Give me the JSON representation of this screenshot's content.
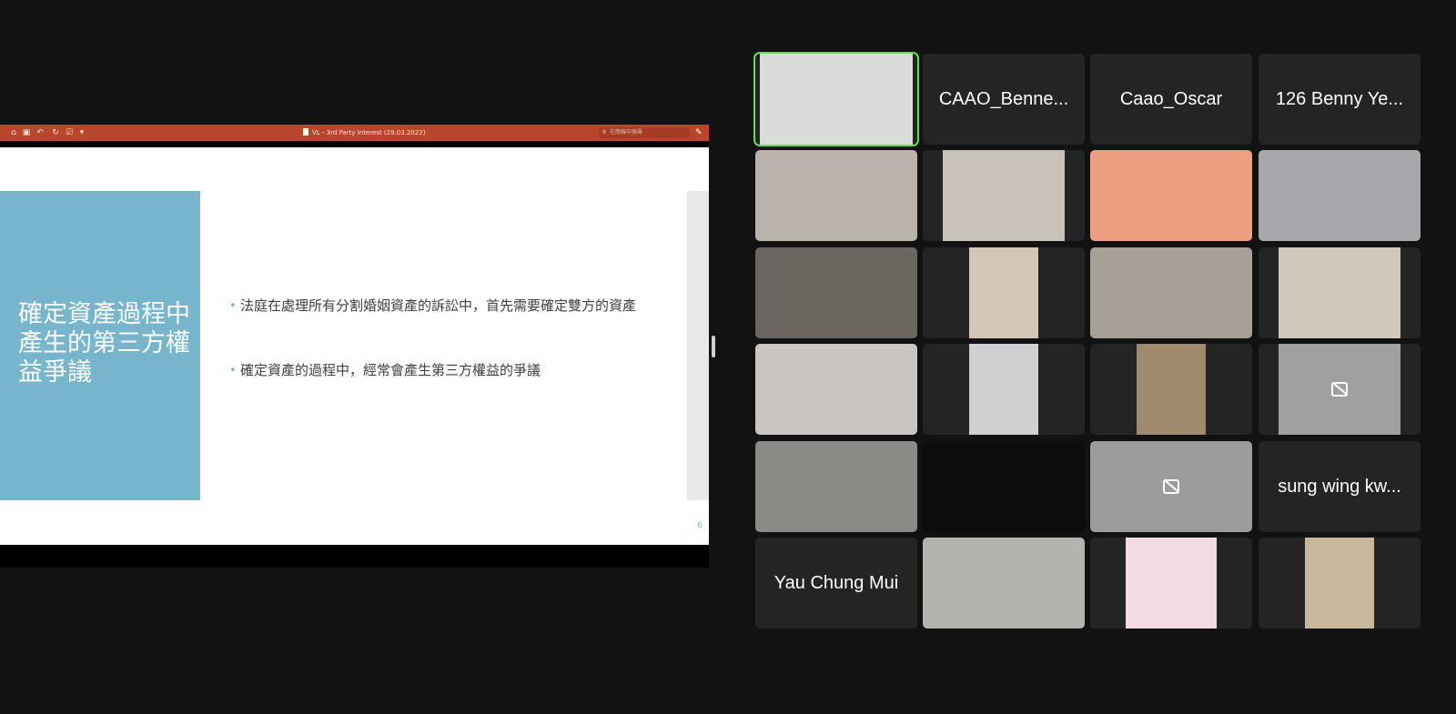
{
  "share": {
    "toolbar": {
      "doc_title": "VL - 3rd Party Interest (29.03.2022)",
      "search_placeholder": "在簡報中搜尋",
      "icons": [
        "home-icon",
        "save-icon",
        "undo-icon",
        "redo-icon",
        "customize-icon",
        "more-icon"
      ],
      "accent": "#b7472a"
    },
    "slide": {
      "title": "確定資產過程中產生的第三方權益爭議",
      "bullets": [
        "法庭在處理所有分割婚姻資產的訴訟中，首先需要確定雙方的資產",
        "確定資產的過程中，經常會產生第三方權益的爭議"
      ],
      "page_number": "6",
      "accent": "#77b5cd"
    }
  },
  "gallery": {
    "tiles": [
      {
        "kind": "video",
        "active": true,
        "bg": "#d9dcd8"
      },
      {
        "kind": "name",
        "name": "CAAO_Benne..."
      },
      {
        "kind": "name",
        "name": "Caao_Oscar"
      },
      {
        "kind": "name",
        "name": "126 Benny Ye..."
      },
      {
        "kind": "video",
        "bg": "#b9b3ab"
      },
      {
        "kind": "video",
        "bg": "#c8c2b8"
      },
      {
        "kind": "video",
        "bg": "#ee9f82"
      },
      {
        "kind": "video",
        "bg": "#a6a6ab"
      },
      {
        "kind": "video",
        "bg": "#6c6660"
      },
      {
        "kind": "video",
        "bg": "#d2c7b7"
      },
      {
        "kind": "video",
        "bg": "#a6a096"
      },
      {
        "kind": "video",
        "bg": "#cfc9bd"
      },
      {
        "kind": "video",
        "bg": "#c9c6c2"
      },
      {
        "kind": "video",
        "bg": "#cfd0d2"
      },
      {
        "kind": "video",
        "bg": "#a08a6c"
      },
      {
        "kind": "camoff",
        "bg": "#a0a0a0"
      },
      {
        "kind": "video",
        "bg": "#8a8a86"
      },
      {
        "kind": "blank"
      },
      {
        "kind": "camoff",
        "bg": "#9c9c9c"
      },
      {
        "kind": "name",
        "name": "sung wing kw..."
      },
      {
        "kind": "name",
        "name": "Yau Chung Mui"
      },
      {
        "kind": "video",
        "bg": "#b5b3b0"
      },
      {
        "kind": "video",
        "bg": "#f3dbe3"
      },
      {
        "kind": "video",
        "bg": "#c8b79c"
      }
    ]
  }
}
